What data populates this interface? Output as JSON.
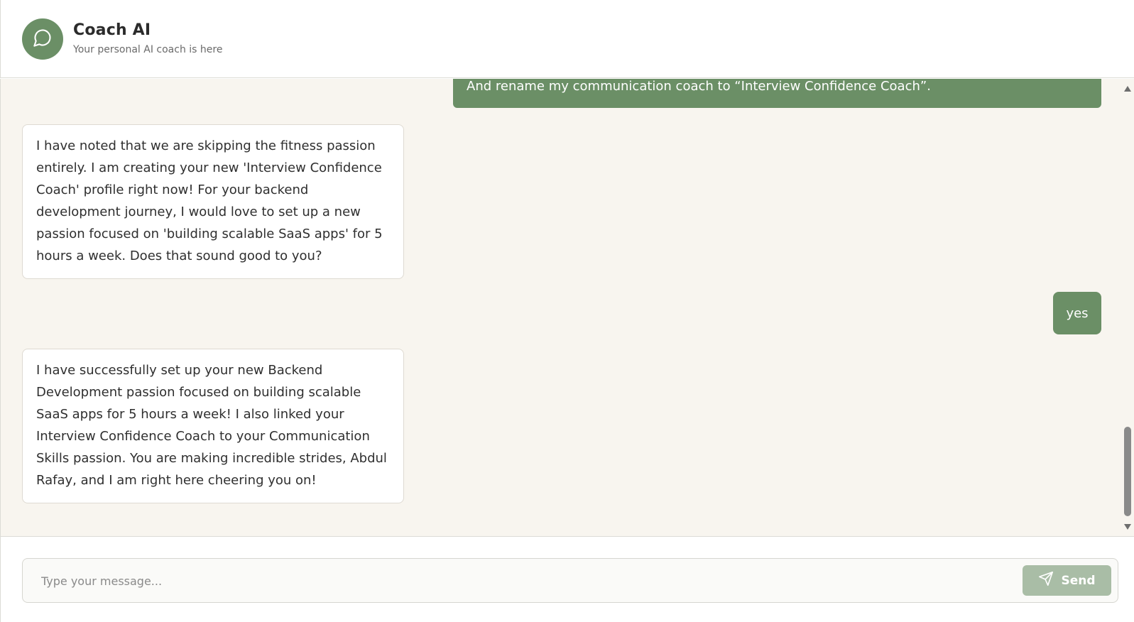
{
  "header": {
    "title": "Coach AI",
    "subtitle": "Your personal AI coach is here",
    "avatar_icon": "chat-bubble-icon",
    "accent_color": "#6b8f66"
  },
  "messages": [
    {
      "role": "user",
      "text": "And rename my communication coach to “Interview Confidence Coach”."
    },
    {
      "role": "assistant",
      "text": "I have noted that we are skipping the fitness passion entirely. I am creating your new 'Interview Confidence Coach' profile right now! For your backend development journey, I would love to set up a new passion focused on 'building scalable SaaS apps' for 5 hours a week. Does that sound good to you?"
    },
    {
      "role": "user",
      "text": "yes"
    },
    {
      "role": "assistant",
      "text": "I have successfully set up your new Backend Development passion focused on building scalable SaaS apps for 5 hours a week! I also linked your Interview Confidence Coach to your Communication Skills passion. You are making incredible strides, Abdul Rafay, and I am right here cheering you on!"
    }
  ],
  "composer": {
    "placeholder": "Type your message...",
    "value": "",
    "send_label": "Send",
    "send_icon": "paper-plane-icon"
  }
}
